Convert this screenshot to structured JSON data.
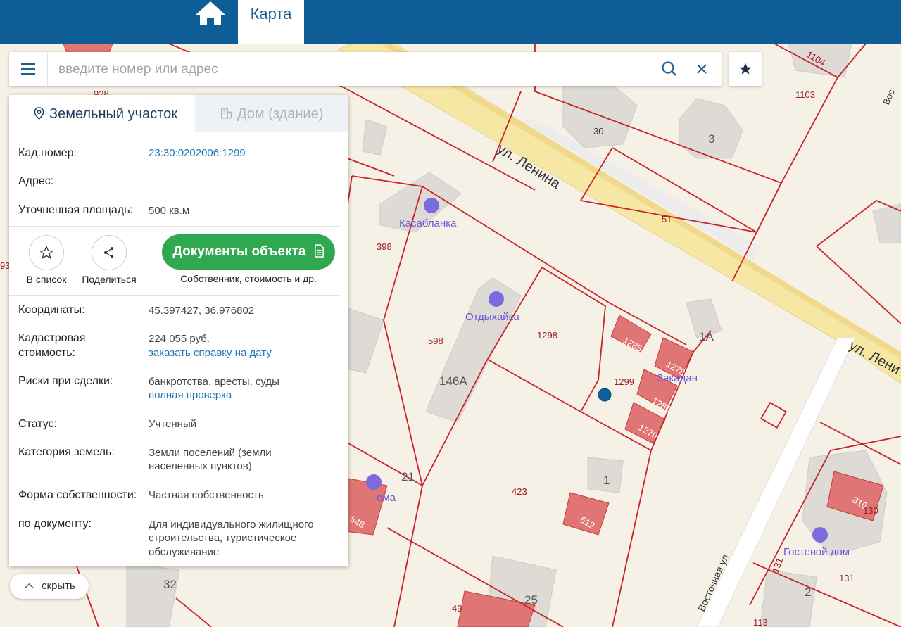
{
  "topbar": {
    "home_icon": "home-icon",
    "tab_label": "Карта",
    "color": "#0f5d96"
  },
  "search": {
    "placeholder": "введите номер или адрес",
    "value": ""
  },
  "panel": {
    "tab_land": "Земельный участок",
    "tab_house": "Дом (здание)",
    "cad_number_label": "Кад.номер:",
    "cad_number_value": "23:30:0202006:1299",
    "address_label": "Адрес:",
    "area_label": "Уточненная площадь:",
    "area_value": "500 кв.м",
    "to_list_label": "В список",
    "share_label": "Поделиться",
    "docs_button": "Документы объекта",
    "docs_sub": "Собственник, стоимость и др.",
    "coords_label": "Координаты:",
    "coords_value": "45.397427, 36.976802",
    "cost_label_1": "Кадастровая",
    "cost_label_2": "стоимость:",
    "cost_value": "224 055 руб.",
    "cost_link": "заказать справку на дату",
    "risks_label": "Риски при сделки:",
    "risks_value": "банкротства, аресты, суды",
    "risks_link": "полная проверка",
    "status_label": "Статус:",
    "status_value": "Учтенный",
    "category_label": "Категория земель:",
    "category_value_1": "Земли поселений (земли",
    "category_value_2": "населенных пунктов)",
    "ownership_label": "Форма собственности:",
    "ownership_value": "Частная собственность",
    "doc_label": "по документу:",
    "doc_value_1": "Для индивидуального жилищного",
    "doc_value_2": "строительства, туристическое",
    "doc_value_3": "обслуживание",
    "accent_green": "#2fa84f",
    "link_color": "#1d78b6"
  },
  "hide_button": "скрыть",
  "map": {
    "streets": [
      "ул. Ленина",
      "ул. Лени",
      "Восточная ул."
    ],
    "streets_cut": [
      "Вос"
    ],
    "pois": [
      "Касабланка",
      "Отдыхайка",
      "Закадан",
      "Гостевой дом"
    ],
    "poi_cut": [
      "ома"
    ],
    "parcel_numbers": [
      "1104",
      "1103",
      "928",
      "30",
      "51",
      "398",
      "598",
      "1298",
      "1285",
      "1278",
      "1299",
      "1280",
      "1279",
      "423",
      "612",
      "848",
      "816",
      "130",
      "131",
      "131",
      "49",
      "113",
      "93"
    ],
    "house_numbers": [
      "3",
      "1А",
      "146А",
      "21",
      "1",
      "32",
      "25",
      "2"
    ],
    "marker": "1299"
  }
}
